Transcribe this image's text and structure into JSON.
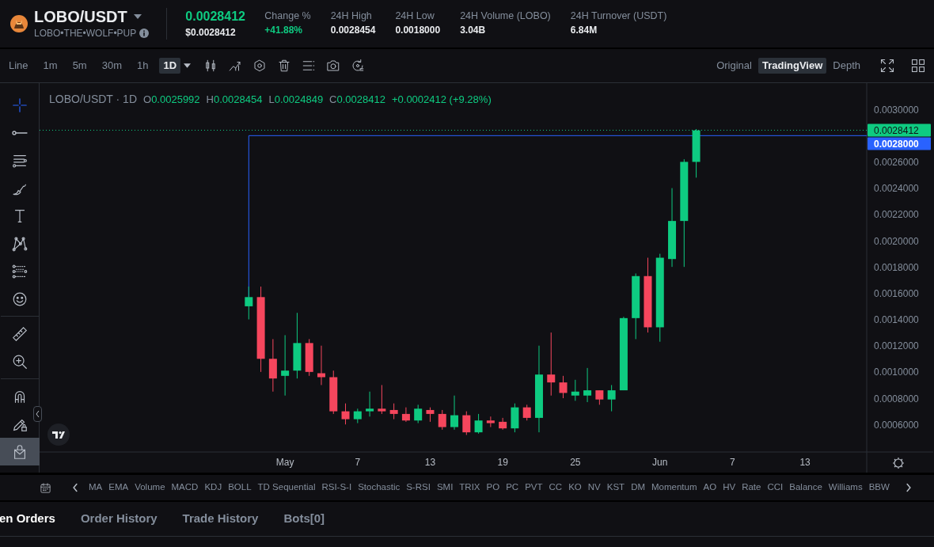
{
  "header": {
    "pair": "LOBO/USDT",
    "token_name": "LOBO•THE•WOLF•PUP",
    "last_price": "0.0028412",
    "usd_price": "$0.0028412",
    "stats": [
      {
        "label": "Change %",
        "value": "+41.88%",
        "kind": "up"
      },
      {
        "label": "24H High",
        "value": "0.0028454",
        "kind": "plain"
      },
      {
        "label": "24H Low",
        "value": "0.0018000",
        "kind": "plain"
      },
      {
        "label": "24H Volume (LOBO)",
        "value": "3.04B",
        "kind": "plain"
      },
      {
        "label": "24H Turnover (USDT)",
        "value": "6.84M",
        "kind": "plain"
      }
    ]
  },
  "toolbar": {
    "intervals": [
      {
        "label": "Line",
        "selected": false
      },
      {
        "label": "1m",
        "selected": false
      },
      {
        "label": "5m",
        "selected": false
      },
      {
        "label": "30m",
        "selected": false
      },
      {
        "label": "1h",
        "selected": false
      },
      {
        "label": "1D",
        "selected": true
      }
    ],
    "views": [
      {
        "label": "Original",
        "selected": false
      },
      {
        "label": "TradingView",
        "selected": true
      },
      {
        "label": "Depth",
        "selected": false
      }
    ]
  },
  "drawing_tools": [
    [
      {
        "kind": "crosshair",
        "selected": true
      },
      {
        "kind": "hline",
        "selected": false
      },
      {
        "kind": "parallel",
        "selected": false
      },
      {
        "kind": "brush",
        "selected": false
      },
      {
        "kind": "text",
        "selected": false
      },
      {
        "kind": "pattern",
        "selected": false
      },
      {
        "kind": "fib",
        "selected": false
      },
      {
        "kind": "emoji",
        "selected": false
      }
    ],
    [
      {
        "kind": "ruler",
        "selected": false
      },
      {
        "kind": "zoom",
        "selected": false
      }
    ],
    [
      {
        "kind": "magnet",
        "toggled": false
      },
      {
        "kind": "lock",
        "toggled": false
      },
      {
        "kind": "hide",
        "toggled": true
      }
    ]
  ],
  "chart": {
    "legend": {
      "symbol": "LOBO/USDT · 1D",
      "items": [
        {
          "key": "O",
          "value": "0.0025992"
        },
        {
          "key": "H",
          "value": "0.0028454"
        },
        {
          "key": "L",
          "value": "0.0024849"
        },
        {
          "key": "C",
          "value": "0.0028412"
        }
      ],
      "change": "+0.0002412 (+9.28%)"
    },
    "price_axis": [
      "0.0030000",
      "0.0026000",
      "0.0024000",
      "0.0022000",
      "0.0020000",
      "0.0018000",
      "0.0016000",
      "0.0014000",
      "0.0012000",
      "0.0010000",
      "0.0008000",
      "0.0006000"
    ],
    "time_axis": [
      "May",
      "7",
      "13",
      "19",
      "25",
      "Jun",
      "7",
      "13"
    ],
    "price_tags": [
      {
        "label": "0.0028412",
        "color": "#0ecb81"
      },
      {
        "label": "0.0028000",
        "color": "#2962ff"
      }
    ]
  },
  "indicators": [
    "MA",
    "EMA",
    "Volume",
    "MACD",
    "KDJ",
    "BOLL",
    "TD Sequential",
    "RSI-S-I",
    "Stochastic",
    "S-RSI",
    "SMI",
    "TRIX",
    "PO",
    "PC",
    "PVT",
    "CC",
    "KO",
    "NV",
    "KST",
    "DM",
    "Momentum",
    "AO",
    "HV",
    "Rate",
    "CCI",
    "Balance",
    "Williams",
    "BBW"
  ],
  "order_tabs": [
    {
      "label": "en Orders",
      "selected": true
    },
    {
      "label": "Order History",
      "selected": false
    },
    {
      "label": "Trade History",
      "selected": false
    },
    {
      "label": "Bots[0]",
      "selected": false
    }
  ]
}
